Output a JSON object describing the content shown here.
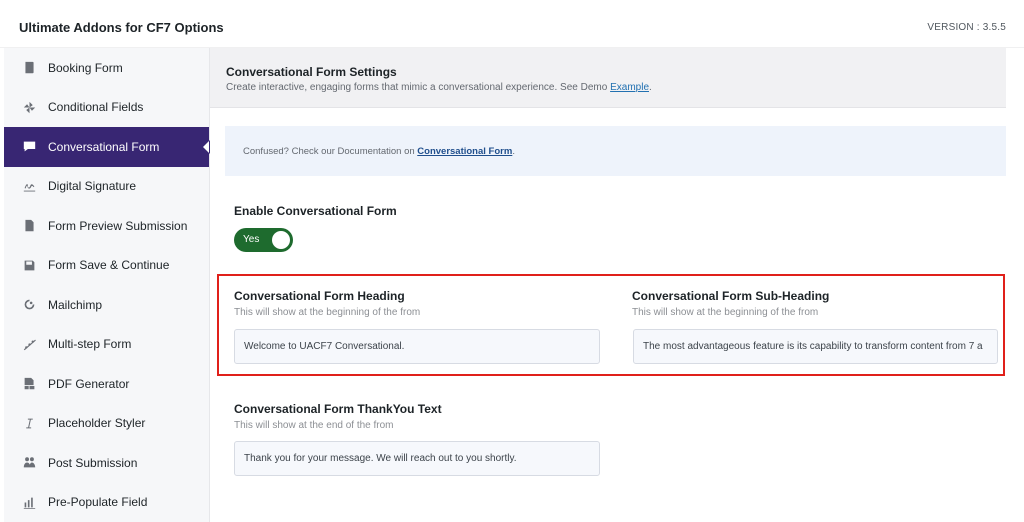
{
  "header": {
    "title": "Ultimate Addons for CF7 Options",
    "version": "VERSION : 3.5.5"
  },
  "sidebar": {
    "items": [
      {
        "label": "Booking Form",
        "icon": "book-icon"
      },
      {
        "label": "Conditional Fields",
        "icon": "pinwheel-icon"
      },
      {
        "label": "Conversational Form",
        "icon": "chat-icon",
        "active": true
      },
      {
        "label": "Digital Signature",
        "icon": "signature-icon"
      },
      {
        "label": "Form Preview Submission",
        "icon": "document-icon"
      },
      {
        "label": "Form Save & Continue",
        "icon": "save-icon"
      },
      {
        "label": "Mailchimp",
        "icon": "mailchimp-icon"
      },
      {
        "label": "Multi-step Form",
        "icon": "steps-icon"
      },
      {
        "label": "PDF Generator",
        "icon": "pdf-icon"
      },
      {
        "label": "Placeholder Styler",
        "icon": "italic-icon"
      },
      {
        "label": "Post Submission",
        "icon": "post-icon"
      },
      {
        "label": "Pre-Populate Field",
        "icon": "prepopulate-icon"
      }
    ]
  },
  "settings": {
    "heading": "Conversational Form Settings",
    "description": "Create interactive, engaging forms that mimic a conversational experience. See Demo",
    "demo_link": "Example",
    "period": "."
  },
  "notice": {
    "text": "Confused? Check our Documentation on",
    "link": "Conversational Form",
    "period": "."
  },
  "enable": {
    "label": "Enable Conversational Form",
    "toggle_text": "Yes"
  },
  "heading_field": {
    "label": "Conversational Form Heading",
    "description": "This will show at the beginning of the from",
    "value": "Welcome to UACF7 Conversational."
  },
  "subheading_field": {
    "label": "Conversational Form Sub-Heading",
    "description": "This will show at the beginning of the from",
    "value": "The most advantageous feature is its capability to transform content from 7 a"
  },
  "thankyou_field": {
    "label": "Conversational Form ThankYou Text",
    "description": "This will show at the end of the from",
    "value": "Thank you for your message. We will reach out to you shortly."
  },
  "colors": {
    "active_nav": "#382673",
    "toggle_on": "#1e6b2e",
    "highlight": "#e0201a",
    "link": "#2271b1"
  }
}
